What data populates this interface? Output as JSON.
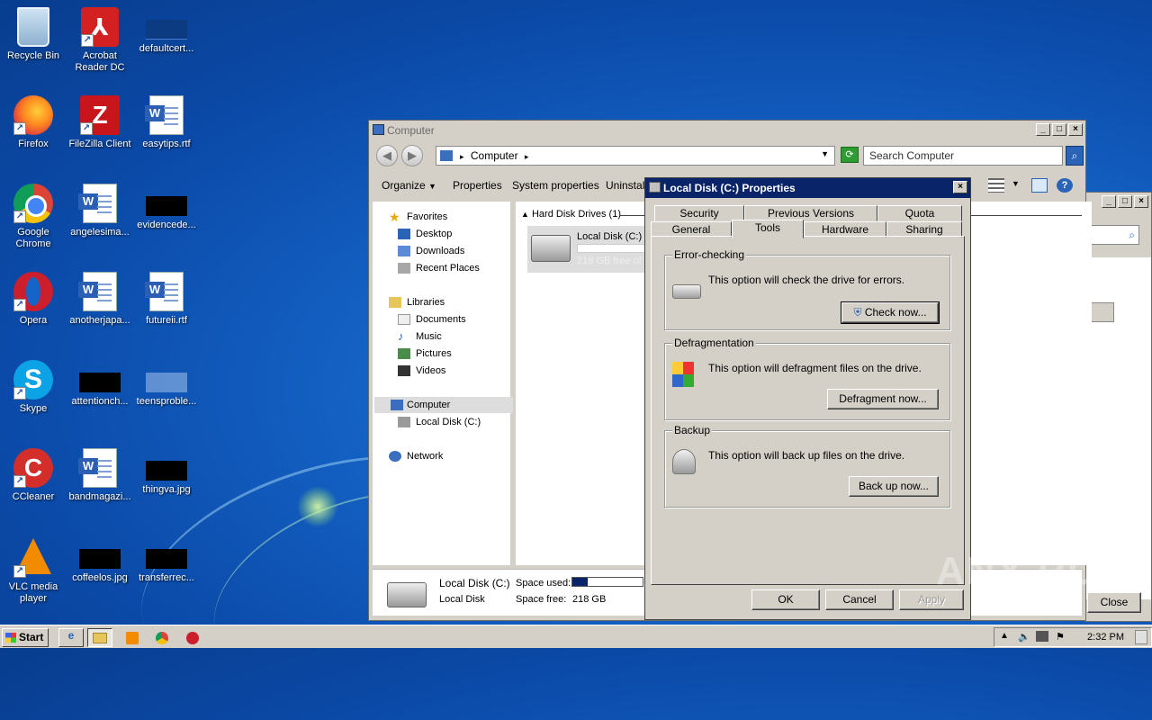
{
  "desktop": {
    "icons": [
      {
        "label": "Recycle Bin"
      },
      {
        "label": "Acrobat Reader DC"
      },
      {
        "label": "defaultcert..."
      },
      {
        "label": "Firefox"
      },
      {
        "label": "FileZilla Client"
      },
      {
        "label": "easytips.rtf"
      },
      {
        "label": "Google Chrome"
      },
      {
        "label": "angelesima..."
      },
      {
        "label": "evidencede..."
      },
      {
        "label": "Opera"
      },
      {
        "label": "anotherjapa..."
      },
      {
        "label": "futureii.rtf"
      },
      {
        "label": "Skype"
      },
      {
        "label": "attentionch..."
      },
      {
        "label": "teensproble..."
      },
      {
        "label": "CCleaner"
      },
      {
        "label": "bandmagazi..."
      },
      {
        "label": "thingva.jpg"
      },
      {
        "label": "VLC media player"
      },
      {
        "label": "coffeelos.jpg"
      },
      {
        "label": "transferrec..."
      }
    ],
    "icon_glyphs": {
      "acrobat": "⅄",
      "filezilla": "Z",
      "skype": "S",
      "ccleaner": "C",
      "word": "W"
    }
  },
  "explorer": {
    "title": "Computer",
    "address": "Computer",
    "search_placeholder": "Search Computer",
    "commands": [
      "Organize",
      "Properties",
      "System properties",
      "Uninstall"
    ],
    "nav": {
      "favorites": "Favorites",
      "desktop": "Desktop",
      "downloads": "Downloads",
      "recent": "Recent Places",
      "libraries": "Libraries",
      "documents": "Documents",
      "music": "Music",
      "pictures": "Pictures",
      "videos": "Videos",
      "computer": "Computer",
      "localdisk": "Local Disk (C:)",
      "network": "Network"
    },
    "group_header": "Hard Disk Drives (1)",
    "drive": {
      "name": "Local Disk (C:)",
      "free": "218 GB free of"
    },
    "details": {
      "name": "Local Disk (C:)",
      "type": "Local Disk",
      "space_used_label": "Space used:",
      "space_free_label": "Space free:",
      "space_free": "218 GB"
    }
  },
  "properties_dialog": {
    "title": "Local Disk (C:) Properties",
    "tabs_back": [
      "Security",
      "Previous Versions",
      "Quota"
    ],
    "tabs_front": [
      "General",
      "Tools",
      "Hardware",
      "Sharing"
    ],
    "active_tab": "Tools",
    "error_checking": {
      "title": "Error-checking",
      "text": "This option will check the drive for errors.",
      "button": "Check now..."
    },
    "defragmentation": {
      "title": "Defragmentation",
      "text": "This option will defragment files on the drive.",
      "button": "Defragment now..."
    },
    "backup": {
      "title": "Backup",
      "text": "This option will back up files on the drive.",
      "button": "Back up now..."
    },
    "ok": "OK",
    "cancel": "Cancel",
    "apply": "Apply"
  },
  "back_window": {
    "close_label": "Close"
  },
  "taskbar": {
    "start": "Start",
    "time": "2:32 PM"
  },
  "watermark": "ANY RUN"
}
